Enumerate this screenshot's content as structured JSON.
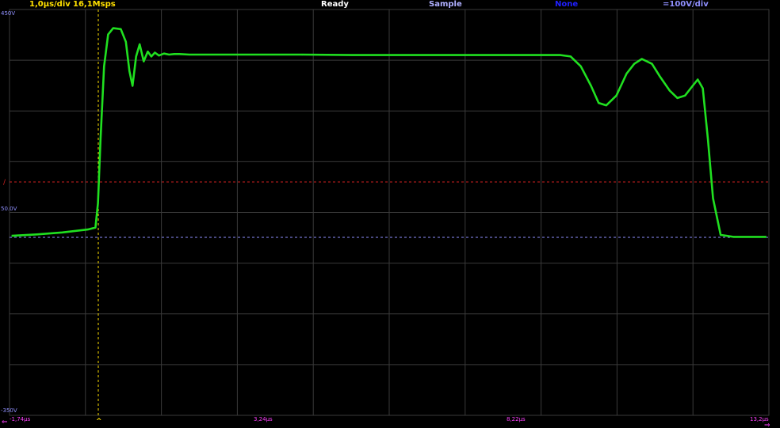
{
  "status_bar": {
    "timebase": "1,0µs/div",
    "sample_rate": "16,1Msps",
    "state": "Ready",
    "mode": "Sample",
    "trigger_mode": "None",
    "volts_div": "=100V/div"
  },
  "y_axis": {
    "top_label": "450V",
    "mid_label": "50.0V",
    "bottom_label": "-350V",
    "trigger_marker": "/"
  },
  "x_axis": {
    "labels": [
      "-1,74µs",
      "3,24µs",
      "8,22µs",
      "13,2µs"
    ],
    "trigger_marker": "^",
    "left_arrow": "⇐",
    "right_arrow": "⇒"
  },
  "colors": {
    "trace": "#20e020",
    "grid": "#3a3a3a",
    "status_yellow": "#ffe000",
    "status_white": "#ffffff",
    "status_lavender": "#b0b0ff",
    "status_blue": "#2020ff",
    "axis_label": "#ff40ff",
    "volt_label": "#9090ff",
    "trigger_level": "#d02020",
    "ground_level": "#9090ff",
    "trigger_time": "#ffe000"
  },
  "chart_data": {
    "type": "line",
    "xlim": [
      -1.74,
      13.2
    ],
    "ylim": [
      -350,
      450
    ],
    "units": {
      "x": "µs",
      "y": "V"
    },
    "trigger_level_v": 40,
    "ground_level_v": 0,
    "trigger_time_us": 0,
    "series": [
      {
        "x": [
          -1.7,
          -1.2,
          -0.7,
          -0.2,
          -0.05,
          0.0,
          0.05,
          0.12,
          0.2,
          0.3,
          0.45,
          0.55,
          0.62,
          0.68,
          0.75,
          0.82,
          0.9,
          0.98,
          1.05,
          1.12,
          1.2,
          1.3,
          1.4,
          1.5,
          1.6,
          1.8,
          2.0,
          2.2,
          3.0,
          4.0,
          5.0,
          6.0,
          7.0,
          8.0,
          8.5,
          8.9,
          9.1,
          9.3,
          9.5,
          9.7,
          9.85,
          10.0,
          10.2,
          10.4,
          10.55,
          10.7,
          10.9,
          11.05,
          11.25,
          11.4,
          11.55,
          11.7,
          11.8,
          11.9,
          12.0,
          12.1,
          12.25,
          12.5,
          12.8,
          13.15
        ],
        "y": [
          3,
          6,
          10,
          16,
          20,
          70,
          200,
          350,
          415,
          428,
          426,
          400,
          340,
          310,
          370,
          395,
          360,
          380,
          370,
          378,
          372,
          376,
          374,
          375,
          375,
          374,
          374,
          374,
          374,
          374,
          373,
          373,
          373,
          373,
          373,
          373,
          373,
          370,
          350,
          310,
          275,
          270,
          290,
          335,
          355,
          365,
          355,
          330,
          300,
          285,
          290,
          310,
          323,
          305,
          200,
          80,
          5,
          1,
          1,
          1
        ]
      }
    ]
  }
}
